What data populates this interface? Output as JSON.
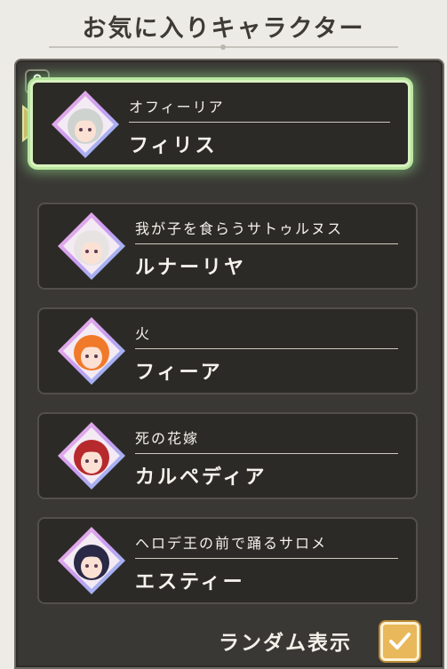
{
  "header": {
    "title": "お気に入りキャラクター"
  },
  "characters": [
    {
      "epithet": "オフィーリア",
      "name": "フィリス",
      "selected": true,
      "avatar_icon": "silver-hair-girl-portrait",
      "hair": "#cfd3cf"
    },
    {
      "epithet": "我が子を食らうサトゥルヌス",
      "name": "ルナーリヤ",
      "selected": false,
      "avatar_icon": "white-hair-red-eye-portrait",
      "hair": "#e7e3e3"
    },
    {
      "epithet": "火",
      "name": "フィーア",
      "selected": false,
      "avatar_icon": "orange-hair-girl-portrait",
      "hair": "#f07a2a"
    },
    {
      "epithet": "死の花嫁",
      "name": "カルペディア",
      "selected": false,
      "avatar_icon": "red-hair-bride-portrait",
      "hair": "#b62a2e"
    },
    {
      "epithet": "ヘロデ王の前で踊るサロメ",
      "name": "エスティー",
      "selected": false,
      "avatar_icon": "dark-hair-dancer-portrait",
      "hair": "#2a2946"
    }
  ],
  "footer": {
    "random_label": "ランダム表示",
    "random_checked": true
  },
  "colors": {
    "selected_glow": "#b9e6a0",
    "checkbox": "#e9b85a",
    "panel": "#3a3835"
  }
}
